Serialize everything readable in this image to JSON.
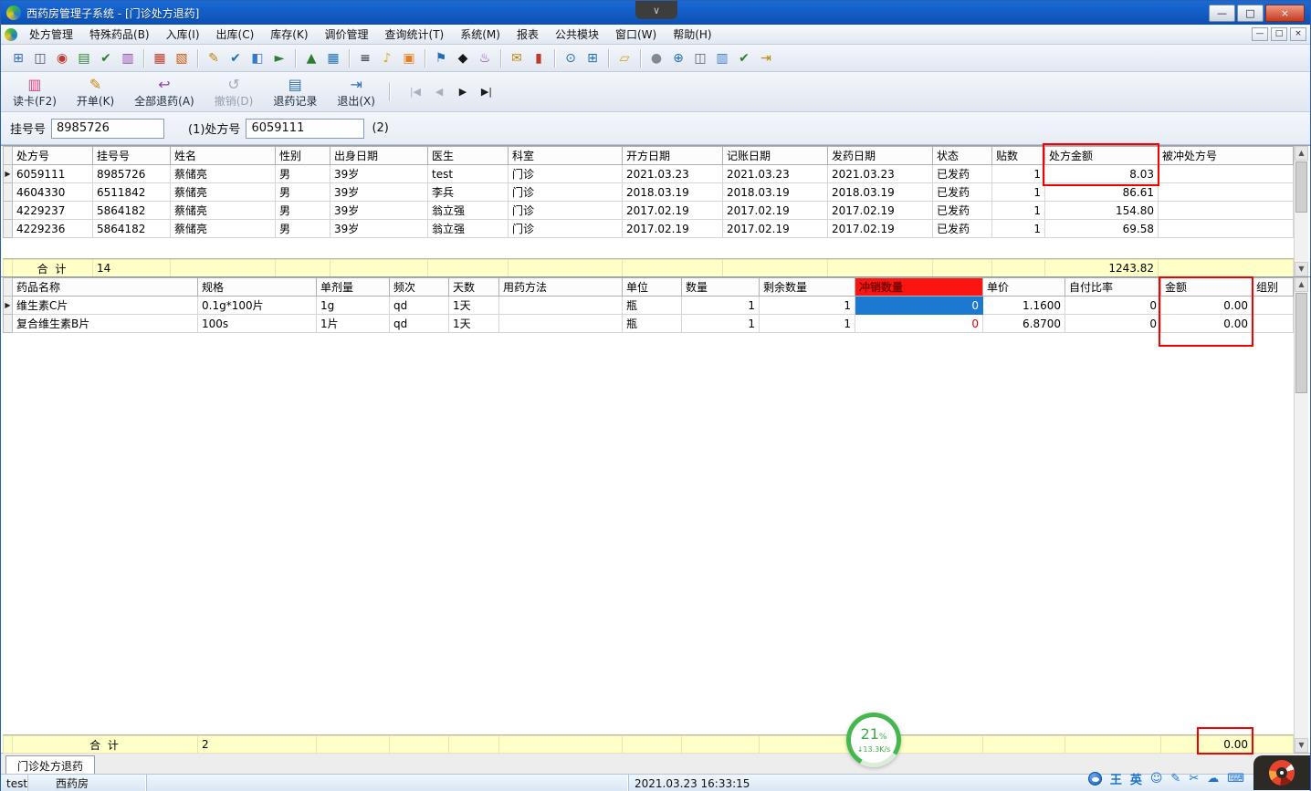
{
  "window": {
    "title": "西药房管理子系统 - [门诊处方退药]",
    "controls": {
      "minimize": "—",
      "maximize": "□",
      "close": "×"
    }
  },
  "vm_tab": {
    "chevron": "∨"
  },
  "menu": {
    "items": [
      "处方管理",
      "特殊药品(B)",
      "入库(I)",
      "出库(C)",
      "库存(K)",
      "调价管理",
      "查询统计(T)",
      "系统(M)",
      "报表",
      "公共模块",
      "窗口(W)",
      "帮助(H)"
    ],
    "child_controls": [
      {
        "name": "mdi-minimize-button",
        "glyph": "—"
      },
      {
        "name": "mdi-restore-button",
        "glyph": "□"
      },
      {
        "name": "mdi-close-button",
        "glyph": "×"
      }
    ]
  },
  "toolbar": {
    "icons": [
      {
        "name": "print-preview-icon",
        "glyph": "⊞",
        "color": "#2f6fc0"
      },
      {
        "name": "printer-icon",
        "glyph": "◫",
        "color": "#44506a"
      },
      {
        "name": "seal-icon",
        "glyph": "◉",
        "color": "#c0392b"
      },
      {
        "name": "ledger-icon",
        "glyph": "▤",
        "color": "#2e7d32"
      },
      {
        "name": "audit-icon",
        "glyph": "✔",
        "color": "#2e7d32"
      },
      {
        "name": "books-icon",
        "glyph": "▥",
        "color": "#8e44ad",
        "sep_after": true
      },
      {
        "name": "dictionary-icon",
        "glyph": "▦",
        "color": "#c0392b"
      },
      {
        "name": "notes-icon",
        "glyph": "▧",
        "color": "#d35400",
        "sep_after": true
      },
      {
        "name": "edit-doc-icon",
        "glyph": "✎",
        "color": "#b8860b"
      },
      {
        "name": "verify-doc-icon",
        "glyph": "✔",
        "color": "#1f6fb2"
      },
      {
        "name": "copy-doc-icon",
        "glyph": "◧",
        "color": "#3a79c9"
      },
      {
        "name": "send-doc-icon",
        "glyph": "►",
        "color": "#2e7d32",
        "sep_after": true
      },
      {
        "name": "line-chart-icon",
        "glyph": "▲",
        "color": "#2e7d32"
      },
      {
        "name": "report-chart-icon",
        "glyph": "▦",
        "color": "#1f6fb2",
        "sep_after": true
      },
      {
        "name": "barcode-icon",
        "glyph": "≡",
        "color": "#222222"
      },
      {
        "name": "bell-icon",
        "glyph": "♪",
        "color": "#e6a817"
      },
      {
        "name": "package-icon",
        "glyph": "▣",
        "color": "#e67e22",
        "sep_after": true
      },
      {
        "name": "pin-icon",
        "glyph": "⚑",
        "color": "#1f6fb2"
      },
      {
        "name": "ink-bottle-icon",
        "glyph": "◆",
        "color": "#16181c"
      },
      {
        "name": "flask-icon",
        "glyph": "♨",
        "color": "#7d3c98",
        "sep_after": true
      },
      {
        "name": "mail-icon",
        "glyph": "✉",
        "color": "#b8860b"
      },
      {
        "name": "thermometer-icon",
        "glyph": "▮",
        "color": "#c0392b",
        "sep_after": true
      },
      {
        "name": "zoom-icon",
        "glyph": "⊙",
        "color": "#1f6fb2"
      },
      {
        "name": "grid-view-icon",
        "glyph": "⊞",
        "color": "#1f6fb2",
        "sep_after": true
      },
      {
        "name": "folder-icon",
        "glyph": "▱",
        "color": "#d4a017",
        "sep_after": true
      },
      {
        "name": "globe-icon",
        "glyph": "●",
        "color": "#7f8c8d"
      },
      {
        "name": "zoom-in-icon",
        "glyph": "⊕",
        "color": "#1f6fb2"
      },
      {
        "name": "split-view-icon",
        "glyph": "◫",
        "color": "#555b66"
      },
      {
        "name": "cards-icon",
        "glyph": "▥",
        "color": "#3a79c9"
      },
      {
        "name": "check-doc-icon",
        "glyph": "✔",
        "color": "#2e7d32"
      },
      {
        "name": "export-icon",
        "glyph": "⇥",
        "color": "#b8860b"
      }
    ]
  },
  "actions": {
    "buttons": [
      {
        "name": "read-card-button",
        "label": "读卡(F2)",
        "glyph": "▥",
        "color": "#e8447a",
        "disabled": false
      },
      {
        "name": "create-order-button",
        "label": "开单(K)",
        "glyph": "✎",
        "color": "#c8860a",
        "disabled": false
      },
      {
        "name": "return-all-button",
        "label": "全部退药(A)",
        "glyph": "↩",
        "color": "#8e44ad",
        "disabled": false
      },
      {
        "name": "undo-button",
        "label": "撤销(D)",
        "glyph": "↺",
        "color": "#9aa4ae",
        "disabled": true
      },
      {
        "name": "return-records-button",
        "label": "退药记录",
        "glyph": "▤",
        "color": "#2f6fb0",
        "disabled": false
      },
      {
        "name": "exit-button",
        "label": "退出(X)",
        "glyph": "⇥",
        "color": "#2f6fb0",
        "disabled": false
      }
    ],
    "nav": [
      {
        "name": "nav-first-button",
        "glyph": "|◀",
        "disabled": true
      },
      {
        "name": "nav-prev-button",
        "glyph": "◀",
        "disabled": true
      },
      {
        "name": "nav-next-button",
        "glyph": "▶",
        "disabled": false
      },
      {
        "name": "nav-last-button",
        "glyph": "▶|",
        "disabled": false
      }
    ]
  },
  "form": {
    "reg_label": "挂号号",
    "reg_value": "8985726",
    "rx_label": "(1)处方号",
    "rx_value": "6059111",
    "rx_suffix": "(2)"
  },
  "prescriptions": {
    "columns": [
      "处方号",
      "挂号号",
      "姓名",
      "性别",
      "出身日期",
      "医生",
      "科室",
      "开方日期",
      "记账日期",
      "发药日期",
      "状态",
      "贴数",
      "处方金额",
      "被冲处方号"
    ],
    "rows": [
      [
        "6059111",
        "8985726",
        "蔡储亮",
        "男",
        "39岁",
        "test",
        "门诊",
        "2021.03.23",
        "2021.03.23",
        "2021.03.23",
        "已发药",
        "1",
        "8.03",
        ""
      ],
      [
        "4604330",
        "6511842",
        "蔡储亮",
        "男",
        "39岁",
        "李兵",
        "门诊",
        "2018.03.19",
        "2018.03.19",
        "2018.03.19",
        "已发药",
        "1",
        "86.61",
        ""
      ],
      [
        "4229237",
        "5864182",
        "蔡储亮",
        "男",
        "39岁",
        "翁立强",
        "门诊",
        "2017.02.19",
        "2017.02.19",
        "2017.02.19",
        "已发药",
        "1",
        "154.80",
        ""
      ],
      [
        "4229236",
        "5864182",
        "蔡储亮",
        "男",
        "39岁",
        "翁立强",
        "门诊",
        "2017.02.19",
        "2017.02.19",
        "2017.02.19",
        "已发药",
        "1",
        "69.58",
        ""
      ]
    ],
    "total": {
      "label": "合  计",
      "count": "14",
      "amount": "1243.82"
    }
  },
  "details": {
    "columns": [
      "药品名称",
      "规格",
      "单剂量",
      "频次",
      "天数",
      "用药方法",
      "单位",
      "数量",
      "剩余数量",
      "冲销数量",
      "单价",
      "自付比率",
      "金额",
      "组别"
    ],
    "rows": [
      [
        "维生素C片",
        "0.1g*100片",
        "1g",
        "qd",
        "1天",
        "",
        "瓶",
        "1",
        "1",
        "0",
        "1.1600",
        "0",
        "0.00",
        ""
      ],
      [
        "复合维生素B片",
        "100s",
        "1片",
        "qd",
        "1天",
        "",
        "瓶",
        "1",
        "1",
        "0",
        "6.8700",
        "0",
        "0.00",
        ""
      ]
    ],
    "total": {
      "label": "合  计",
      "count": "2",
      "amount": "0.00"
    }
  },
  "progress": {
    "percent": "21",
    "unit": "%",
    "speed": "↓13.3K/s"
  },
  "tabs": {
    "active": "门诊处方退药"
  },
  "status": {
    "user": "test",
    "department": "西药房",
    "datetime": "2021.03.23 16:33:15"
  },
  "ime": {
    "mode1": "王",
    "mode2": "英",
    "icons": [
      {
        "name": "ime-smiley-icon",
        "glyph": "☺"
      },
      {
        "name": "ime-pen-icon",
        "glyph": "✎"
      },
      {
        "name": "ime-scissors-icon",
        "glyph": "✂"
      },
      {
        "name": "ime-cloud-icon",
        "glyph": "☁"
      },
      {
        "name": "ime-keyboard-icon",
        "glyph": "⌨"
      }
    ]
  },
  "colors": {
    "accent_red": "#ff0000",
    "selected_cell": "#1b79d2",
    "total_row_bg": "#ffffc8",
    "title_bar": "#0f5bc5"
  }
}
